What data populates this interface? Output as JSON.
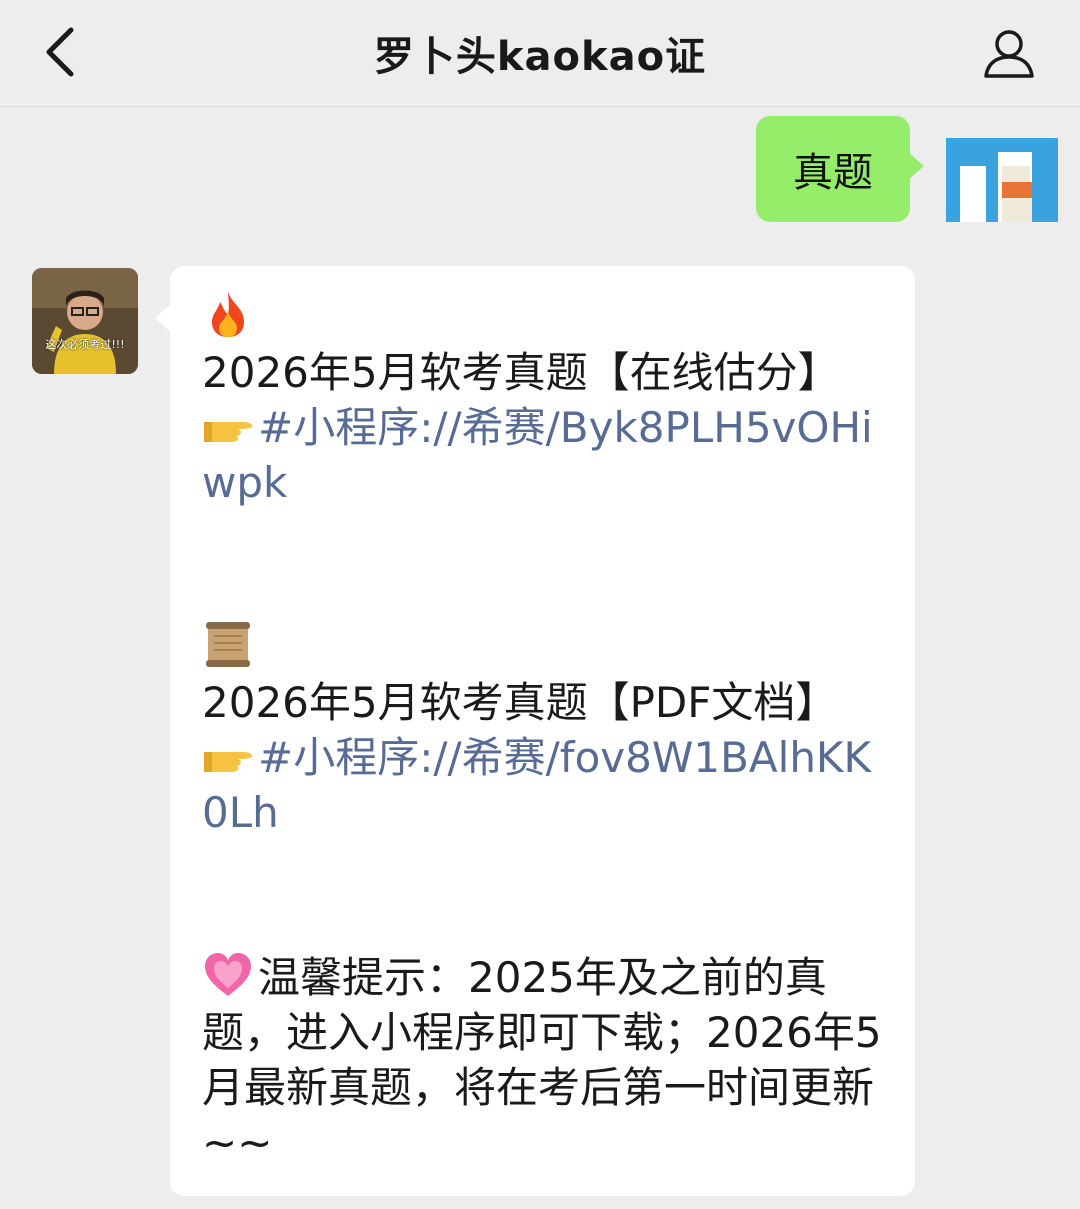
{
  "header": {
    "title": "罗卜头kaokao证",
    "back_icon": "chevron-left-icon",
    "profile_icon": "person-icon"
  },
  "outgoing_message": {
    "text": "真题"
  },
  "incoming_message": {
    "avatar_caption": "这次必须考过!!!",
    "blocks": [
      {
        "icon": "fire-emoji",
        "heading": "2026年5月软考真题【在线估分】",
        "link": "#小程序://希赛/Byk8PLH5vOHiwpk"
      },
      {
        "icon": "scroll-emoji",
        "heading": "2026年5月软考真题【PDF文档】",
        "link": "#小程序://希赛/fov8W1BAlhKK0Lh"
      },
      {
        "icon": "heart-emoji",
        "notice": "温馨提示：2025年及之前的真题，进入小程序即可下载；2026年5月最新真题，将在考后第一时间更新~~"
      }
    ]
  },
  "colors": {
    "background": "#ededed",
    "outgoing_bubble": "#95ec69",
    "incoming_bubble": "#ffffff",
    "link": "#576b95"
  }
}
